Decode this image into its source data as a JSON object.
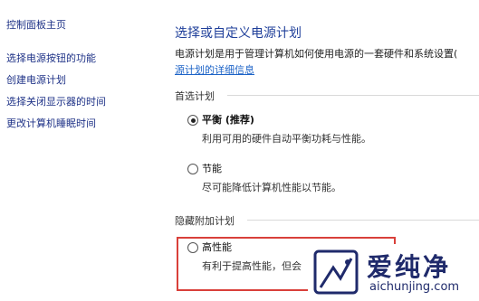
{
  "sidebar": {
    "home": "控制面板主页",
    "links": [
      "选择电源按钮的功能",
      "创建电源计划",
      "选择关闭显示器的时间",
      "更改计算机睡眠时间"
    ]
  },
  "main": {
    "title": "选择或自定义电源计划",
    "description": "电源计划是用于管理计算机如何使用电源的一套硬件和系统设置(",
    "link": "源计划的详细信息",
    "preferred": {
      "heading": "首选计划",
      "plans": [
        {
          "name": "平衡 (推荐)",
          "desc": "利用可用的硬件自动平衡功耗与性能。",
          "selected": true
        },
        {
          "name": "节能",
          "desc": "尽可能降低计算机性能以节能。",
          "selected": false
        }
      ]
    },
    "hidden": {
      "heading": "隐藏附加计划",
      "plans": [
        {
          "name": "高性能",
          "desc": "有利于提高性能，但会",
          "selected": false
        }
      ]
    }
  },
  "colors": {
    "link": "#1e3287",
    "title": "#1f3f9a",
    "highlight_border": "#d9403a"
  },
  "watermark": {
    "cn": "爱纯净",
    "en": "aichunjing.com"
  }
}
